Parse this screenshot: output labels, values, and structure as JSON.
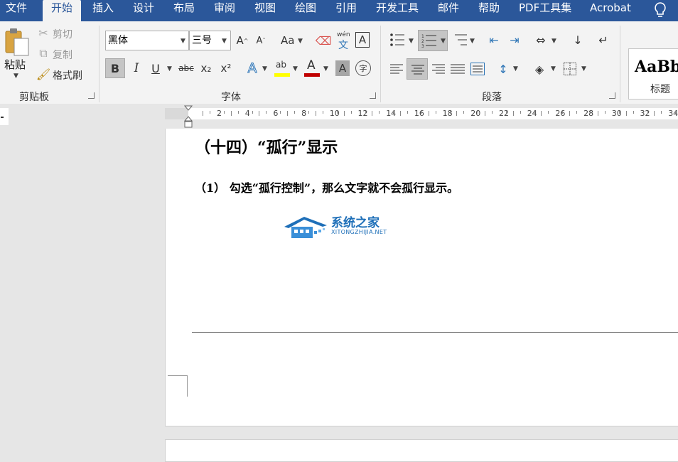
{
  "tabs": [
    "文件",
    "开始",
    "插入",
    "设计",
    "布局",
    "审阅",
    "视图",
    "绘图",
    "引用",
    "开发工具",
    "邮件",
    "帮助",
    "PDF工具集",
    "Acrobat"
  ],
  "clipboard": {
    "paste": "粘贴",
    "cut": "剪切",
    "copy": "复制",
    "format_painter": "格式刷",
    "label": "剪贴板"
  },
  "font": {
    "family": "黑体",
    "size": "三号",
    "label": "字体",
    "case_label": "Aa",
    "pinyin_top": "wén",
    "pinyin_bottom": "文",
    "border_char": "A"
  },
  "font_format": {
    "bold": "B",
    "italic": "I",
    "underline": "U",
    "strikethrough": "abc",
    "subscript": "x₂",
    "superscript": "x²",
    "text_effect": "A",
    "highlight": "ab",
    "font_color": "A",
    "char_shading": "A",
    "enclose": "字"
  },
  "paragraph": {
    "label": "段落"
  },
  "styles": {
    "preview": "AaBb",
    "name": "标题"
  },
  "ruler": [
    "2",
    "4",
    "6",
    "8",
    "10",
    "12",
    "14",
    "16",
    "18",
    "20",
    "22",
    "24",
    "26",
    "28",
    "30",
    "32",
    "34"
  ],
  "document": {
    "heading": "（十四）“孤行”显示",
    "paragraph": "（1） 勾选“孤行控制”，那么文字就不会孤行显示。"
  },
  "watermark": {
    "name": "系统之家",
    "url": "XITONGZHIJIA.NET"
  },
  "colors": {
    "accent": "#2b579a",
    "highlight": "#ffff00",
    "font_color": "#c00000",
    "text_effect": "#2e75b6"
  }
}
